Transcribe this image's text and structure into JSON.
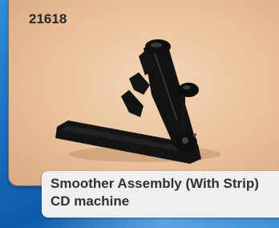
{
  "product": {
    "part_number": "21618",
    "title": "Smoother Assembly (With Strip)",
    "subtitle": "CD machine"
  },
  "colors": {
    "background_blue": "#1c6fc0",
    "card_beige": "#e9c09a",
    "caption_bg": "#efefef",
    "text_dark": "#303030",
    "part_black": "#141414"
  }
}
